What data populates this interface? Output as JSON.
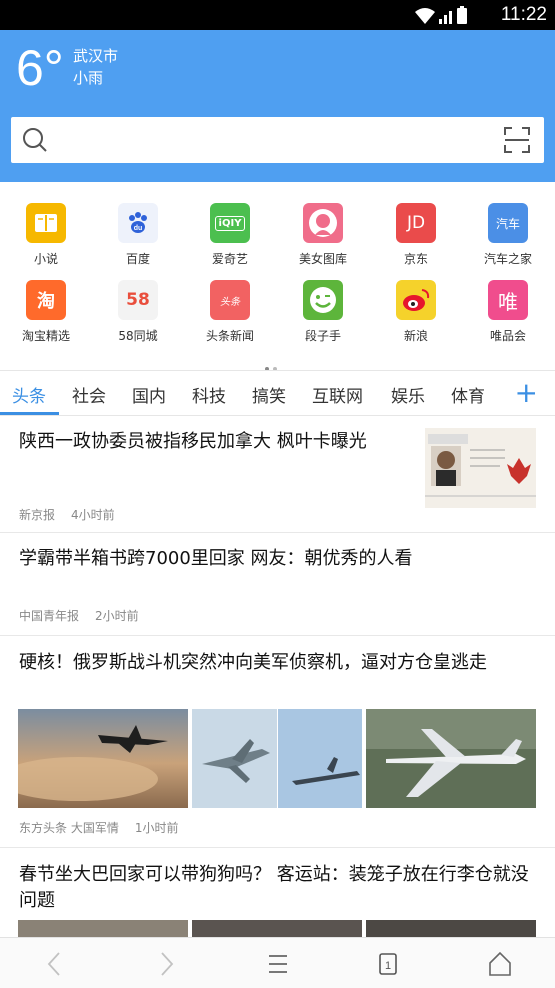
{
  "status_bar": {
    "time": "11:22"
  },
  "weather": {
    "temperature": "6°",
    "city": "武汉市",
    "condition": "小雨"
  },
  "shortcuts": [
    {
      "label": "小说",
      "icon": "book-icon",
      "color": "#f6b800",
      "glyph": ""
    },
    {
      "label": "百度",
      "icon": "baidu-paw-icon",
      "color": "#eef2fb",
      "glyph": "du"
    },
    {
      "label": "爱奇艺",
      "icon": "iqiyi-icon",
      "color": "#4cbf4f",
      "glyph": "iQIY"
    },
    {
      "label": "美女图库",
      "icon": "beauty-gallery-icon",
      "color": "#f06d8a",
      "glyph": ""
    },
    {
      "label": "京东",
      "icon": "jd-icon",
      "color": "#ea4b4b",
      "glyph": "JD"
    },
    {
      "label": "汽车之家",
      "icon": "autohome-icon",
      "color": "#4b8fe6",
      "glyph": "汽车"
    },
    {
      "label": "淘宝精选",
      "icon": "taobao-icon",
      "color": "#ff6a2b",
      "glyph": "淘"
    },
    {
      "label": "58同城",
      "icon": "58-icon",
      "color": "#f3f3f3",
      "glyph": "58"
    },
    {
      "label": "头条新闻",
      "icon": "toutiao-icon",
      "color": "#f26262",
      "glyph": "头条"
    },
    {
      "label": "段子手",
      "icon": "duanzi-smile-icon",
      "color": "#5db53b",
      "glyph": "☻"
    },
    {
      "label": "新浪",
      "icon": "weibo-icon",
      "color": "#f5d22b",
      "glyph": ""
    },
    {
      "label": "唯品会",
      "icon": "vip-icon",
      "color": "#f04d8d",
      "glyph": "唯"
    }
  ],
  "tabs": [
    "头条",
    "社会",
    "国内",
    "科技",
    "搞笑",
    "互联网",
    "娱乐",
    "体育"
  ],
  "add_tab_label": "+",
  "news": [
    {
      "title": "陕西一政协委员被指移民加拿大 枫叶卡曝光",
      "source": "新京报",
      "time": "4小时前"
    },
    {
      "title": "学霸带半箱书跨7000里回家 网友：朝优秀的人看",
      "source": "中国青年报",
      "time": "2小时前"
    },
    {
      "title": "硬核！俄罗斯战斗机突然冲向美军侦察机，逼对方仓皇逃走",
      "source": "东方头条 大国军情",
      "time": "1小时前"
    },
    {
      "title": "春节坐大巴回家可以带狗狗吗？ 客运站：装笼子放在行李仓就没问题",
      "source": "",
      "time": ""
    }
  ],
  "accent_color": "#3b8fe3",
  "header_color": "#4f9ff1"
}
